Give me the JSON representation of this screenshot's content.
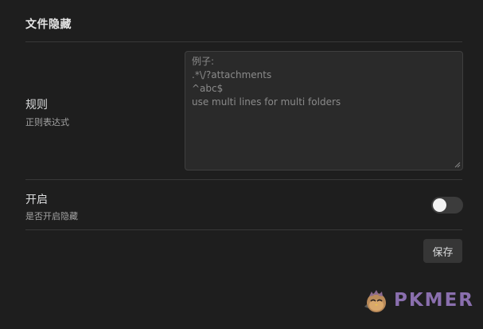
{
  "section": {
    "title": "文件隐藏"
  },
  "rules": {
    "name": "规则",
    "description": "正则表达式",
    "textarea_value": "",
    "textarea_placeholder": "例子:\n.*\\/?attachments\n^abc$\nuse multi lines for multi folders"
  },
  "enable": {
    "name": "开启",
    "description": "是否开启隐藏",
    "toggle_on": false
  },
  "actions": {
    "save_label": "保存"
  },
  "watermark": {
    "text": "PKMER",
    "logo_icon": "bird-logo-icon",
    "text_color": "#8a6fae"
  },
  "colors": {
    "background": "#1e1e1e",
    "input_background": "#2a2a2a",
    "toggle_off": "#3c3c3c"
  }
}
